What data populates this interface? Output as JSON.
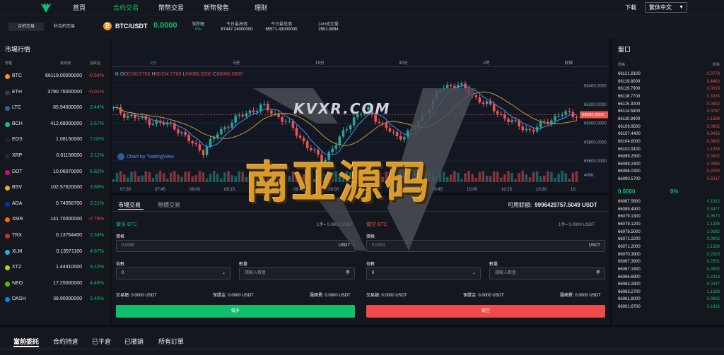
{
  "nav": {
    "items": [
      "首頁",
      "合約交易",
      "幣幣交易",
      "新幣發售",
      "理財"
    ],
    "active": 1,
    "download": "下載",
    "language": "繁体中文"
  },
  "modes": [
    "合約交易",
    "秒合約交易"
  ],
  "ticker": {
    "pair": "BTC/USDT",
    "price": "0.0000",
    "change_label": "漲跌幅",
    "change": "0%",
    "high_label": "今日最高價",
    "high": "67447.24000000",
    "low_label": "今日最低價",
    "low": "65571.43000000",
    "vol_label": "24H成交量",
    "vol": "2501.8894"
  },
  "market": {
    "title": "市場行情",
    "headers": [
      "幣種",
      "最新價",
      "漲跌幅"
    ],
    "rows": [
      {
        "sym": "BTC",
        "price": "66119.00000000",
        "change": "-0.54%",
        "dir": "dn",
        "color": "#f7931a"
      },
      {
        "sym": "ETH",
        "price": "3790.76000000",
        "change": "-0.01%",
        "dir": "dn",
        "color": "#3c3c3d"
      },
      {
        "sym": "LTC",
        "price": "85.94000000",
        "change": "3.44%",
        "dir": "up",
        "color": "#345d9d"
      },
      {
        "sym": "BCH",
        "price": "412.68000000",
        "change": "2.67%",
        "dir": "up",
        "color": "#0ac18e"
      },
      {
        "sym": "EOS",
        "price": "1.08150000",
        "change": "7.02%",
        "dir": "up",
        "color": "#222"
      },
      {
        "sym": "XRP",
        "price": "0.61158000",
        "change": "2.11%",
        "dir": "up",
        "color": "#23292f"
      },
      {
        "sym": "DOT",
        "price": "10.06070000",
        "change": "6.82%",
        "dir": "up",
        "color": "#e6007a"
      },
      {
        "sym": "BSV",
        "price": "102.57620000",
        "change": "3.66%",
        "dir": "up",
        "color": "#eab300"
      },
      {
        "sym": "ADA",
        "price": "0.74058700",
        "change": "3.21%",
        "dir": "up",
        "color": "#0033ad"
      },
      {
        "sym": "XMR",
        "price": "141.70000000",
        "change": "-2.78%",
        "dir": "dn",
        "color": "#ff6600"
      },
      {
        "sym": "TRX",
        "price": "0.13764400",
        "change": "0.34%",
        "dir": "up",
        "color": "#c2332f"
      },
      {
        "sym": "XLM",
        "price": "0.13971100",
        "change": "4.67%",
        "dir": "up",
        "color": "#14b6e7"
      },
      {
        "sym": "XTZ",
        "price": "1.44410000",
        "change": "9.10%",
        "dir": "up",
        "color": "#a6e000"
      },
      {
        "sym": "NEO",
        "price": "17.25000000",
        "change": "4.48%",
        "dir": "up",
        "color": "#58bf00"
      },
      {
        "sym": "DASH",
        "price": "38.90000000",
        "change": "3.48%",
        "dir": "up",
        "color": "#008ce7"
      }
    ]
  },
  "chart": {
    "timeframes": [
      "1分",
      "5分",
      "15分",
      "30分",
      "1時",
      "日線"
    ],
    "active_tf": 0,
    "ohlc": {
      "o": "66150.5700",
      "h": "66154.5700",
      "l": "66088.0200",
      "c": "66090.5600"
    },
    "price_ticks": [
      "66400.0000",
      "66200.0000",
      "66000.0000",
      "65800.0000",
      "65600.0000"
    ],
    "last_price": "66090.5600",
    "vol_tick": "400K",
    "time_ticks": [
      "07:30",
      "07:45",
      "08:00",
      "08:15",
      "08:30",
      "08:45",
      "09:00",
      "09:15",
      "09:30",
      "09:45",
      "10:00",
      "10:15",
      "10:30",
      "10:"
    ],
    "brand": "Chart by TradingView",
    "chart_data": {
      "type": "candlestick",
      "ylim": [
        65600,
        66400
      ],
      "last": 66090.56
    }
  },
  "trade": {
    "tabs": [
      "市場交易",
      "限價交易"
    ],
    "available_label": "可用餘額:",
    "available": "9996429757.5049 USDT",
    "long": {
      "title": "做多 BTC",
      "rate": "1手= 0.0000 USDT",
      "price_label": "價格",
      "price": "0.0000",
      "unit": "USDT",
      "lev_label": "倍數",
      "lev": "0",
      "qty_label": "數量",
      "qty_ph": "請輸入數量",
      "qty_unit": "手",
      "fee1": "交易額: 0.0000 USDT",
      "fee2": "保證金: 0.0000 USDT",
      "fee3": "服務費: 0.0000 USDT",
      "btn": "做多"
    },
    "short": {
      "title": "做空 BTC",
      "rate": "1手= 0.0000 USDT",
      "price_label": "價格",
      "price": "0.0000",
      "unit": "USDT",
      "lev_label": "倍數",
      "lev": "0",
      "qty_label": "數量",
      "qty_ph": "請輸入數量",
      "qty_unit": "手",
      "fee1": "交易額: 0.0000 USDT",
      "fee2": "保證金: 0.0000 USDT",
      "fee3": "服務費: 0.0000 USDT",
      "btn": "做空"
    }
  },
  "book": {
    "title": "盤口",
    "headers": [
      "價格",
      "數量"
    ],
    "asks": [
      [
        "66121.8100",
        "0.0778"
      ],
      [
        "66119.8000",
        "0.4460"
      ],
      [
        "66119.7900",
        "0.0019"
      ],
      [
        "66118.7700",
        "0.3335"
      ],
      [
        "66115.3000",
        "0.0902"
      ],
      [
        "66114.5800",
        "0.0787"
      ],
      [
        "66110.8400",
        "1.1338"
      ],
      [
        "66109.9500",
        "0.0902"
      ],
      [
        "66107.4400",
        "0.8426"
      ],
      [
        "66104.6000",
        "0.0902"
      ],
      [
        "66102.9100",
        "1.1338"
      ],
      [
        "66099.2500",
        "0.0902"
      ],
      [
        "66099.2400",
        "0.0065"
      ],
      [
        "66096.0300",
        "0.2000"
      ],
      [
        "66090.5700",
        "0.5017"
      ]
    ],
    "mid_price": "0.0000",
    "mid_change": "0%",
    "bids": [
      [
        "66087.5600",
        "0.1915"
      ],
      [
        "66089.4900",
        "0.3477"
      ],
      [
        "66079.1300",
        "0.0570"
      ],
      [
        "66079.1200",
        "1.1338"
      ],
      [
        "66078.5000",
        "1.0582"
      ],
      [
        "66071.2200",
        "0.0902"
      ],
      [
        "66071.2000",
        "1.1338"
      ],
      [
        "66070.3900",
        "0.2520"
      ],
      [
        "66067.3900",
        "0.2501"
      ],
      [
        "66067.1500",
        "0.0902"
      ],
      [
        "66066.6900",
        "0.2318"
      ],
      [
        "66063.2800",
        "0.0047"
      ],
      [
        "66063.2700",
        "1.1338"
      ],
      [
        "66061.8000",
        "0.0902"
      ],
      [
        "66061.6700",
        "0.1816"
      ]
    ]
  },
  "bottom": {
    "tabs": [
      "當前委託",
      "合約持倉",
      "已平倉",
      "已撤銷",
      "所有訂單"
    ]
  },
  "watermark": {
    "site": "KVXR.COM",
    "text": "南亚源码"
  }
}
